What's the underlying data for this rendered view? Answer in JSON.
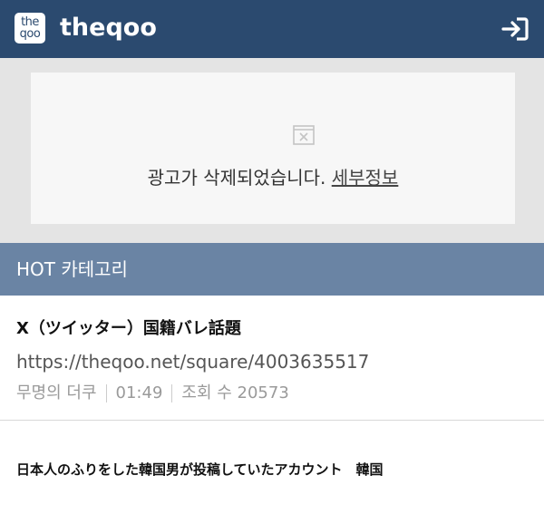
{
  "header": {
    "logo_line1": "the",
    "logo_line2": "qoo",
    "brand": "theqoo",
    "login_icon": "login-arrow-icon"
  },
  "ad": {
    "icon": "broken-image-icon",
    "message": "광고가 삭제되었습니다.",
    "detail_link": "세부정보"
  },
  "category": {
    "title": "HOT 카테고리"
  },
  "posts": [
    {
      "title": "X（ツイッター）国籍バレ話題",
      "url": "https://theqoo.net/square/4003635517",
      "author": "무명의 더쿠",
      "time": "01:49",
      "views": "조회 수 20573"
    },
    {
      "title": "日本人のふりをした韓国男が投稿していたアカウント　韓国"
    }
  ],
  "colors": {
    "header_bg": "#2b4a6f",
    "category_bg": "#6a84a4",
    "ad_bg": "#e4e4e4"
  }
}
